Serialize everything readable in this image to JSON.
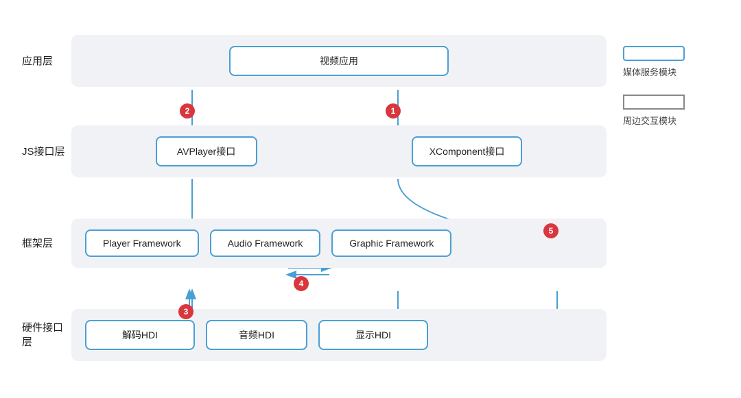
{
  "layers": {
    "app": {
      "label": "应用层",
      "box": "视频应用"
    },
    "js": {
      "label": "JS接口层",
      "box1": "AVPlayer接口",
      "box2": "XComponent接口"
    },
    "framework": {
      "label": "框架层",
      "box1": "Player Framework",
      "box2": "Audio Framework",
      "box3": "Graphic Framework"
    },
    "hardware": {
      "label": "硬件接口层",
      "box1": "解码HDI",
      "box2": "音频HDI",
      "box3": "显示HDI"
    }
  },
  "legend": {
    "media_label": "媒体服务模块",
    "peripheral_label": "周边交互模块"
  },
  "badges": {
    "b1": "1",
    "b2": "2",
    "b3": "3",
    "b4": "4",
    "b5": "5"
  }
}
